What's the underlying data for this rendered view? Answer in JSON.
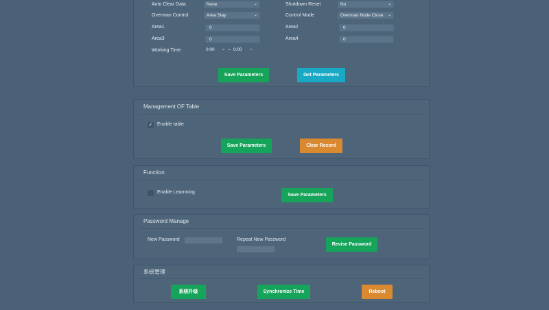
{
  "params": {
    "auto_clear_label": "Auto Clear Data",
    "auto_clear_value": "None",
    "shutdown_reset_label": "Shutdown Reset",
    "shutdown_reset_value": "No",
    "overman_control_label": "Overman Control",
    "overman_control_value": "Area Stay",
    "control_mode_label": "Control Mode",
    "control_mode_value": "Overman Node Close",
    "area1_label": "Area1",
    "area1_value": "0",
    "area2_label": "Area2",
    "area2_value": "0",
    "area3_label": "Area3",
    "area3_value": "0",
    "area4_label": "Area4",
    "area4_value": "0",
    "working_time_label": "Working Time",
    "working_time_start": "0:00",
    "working_time_sep": "~",
    "working_time_end": "0:00",
    "save_label": "Save Parameters",
    "get_label": "Get Parameters"
  },
  "table": {
    "title": "Management OF Table",
    "enable_label": "Enable table",
    "enable_checked": true,
    "save_label": "Save Parameters",
    "clear_label": "Clear Record"
  },
  "function": {
    "title": "Function",
    "learning_label": "Enable Learnning",
    "learning_checked": false,
    "save_label": "Save Parameters"
  },
  "password": {
    "title": "Password Manage",
    "new_label": "New Password",
    "new_value": "",
    "repeat_label": "Repeat New Password",
    "repeat_value": "",
    "revise_label": "Revise Password"
  },
  "system": {
    "title": "系统管理",
    "upgrade_label": "系统升级",
    "sync_label": "Synchronize Time",
    "reboot_label": "Reboot"
  },
  "colors": {
    "background": "#4a6178",
    "green": "#16a35a",
    "cyan": "#1aa9c4",
    "orange": "#d9892f"
  },
  "icons": {
    "checkbox_checked": "check-icon",
    "select_arrow": "chevron-down-icon"
  }
}
